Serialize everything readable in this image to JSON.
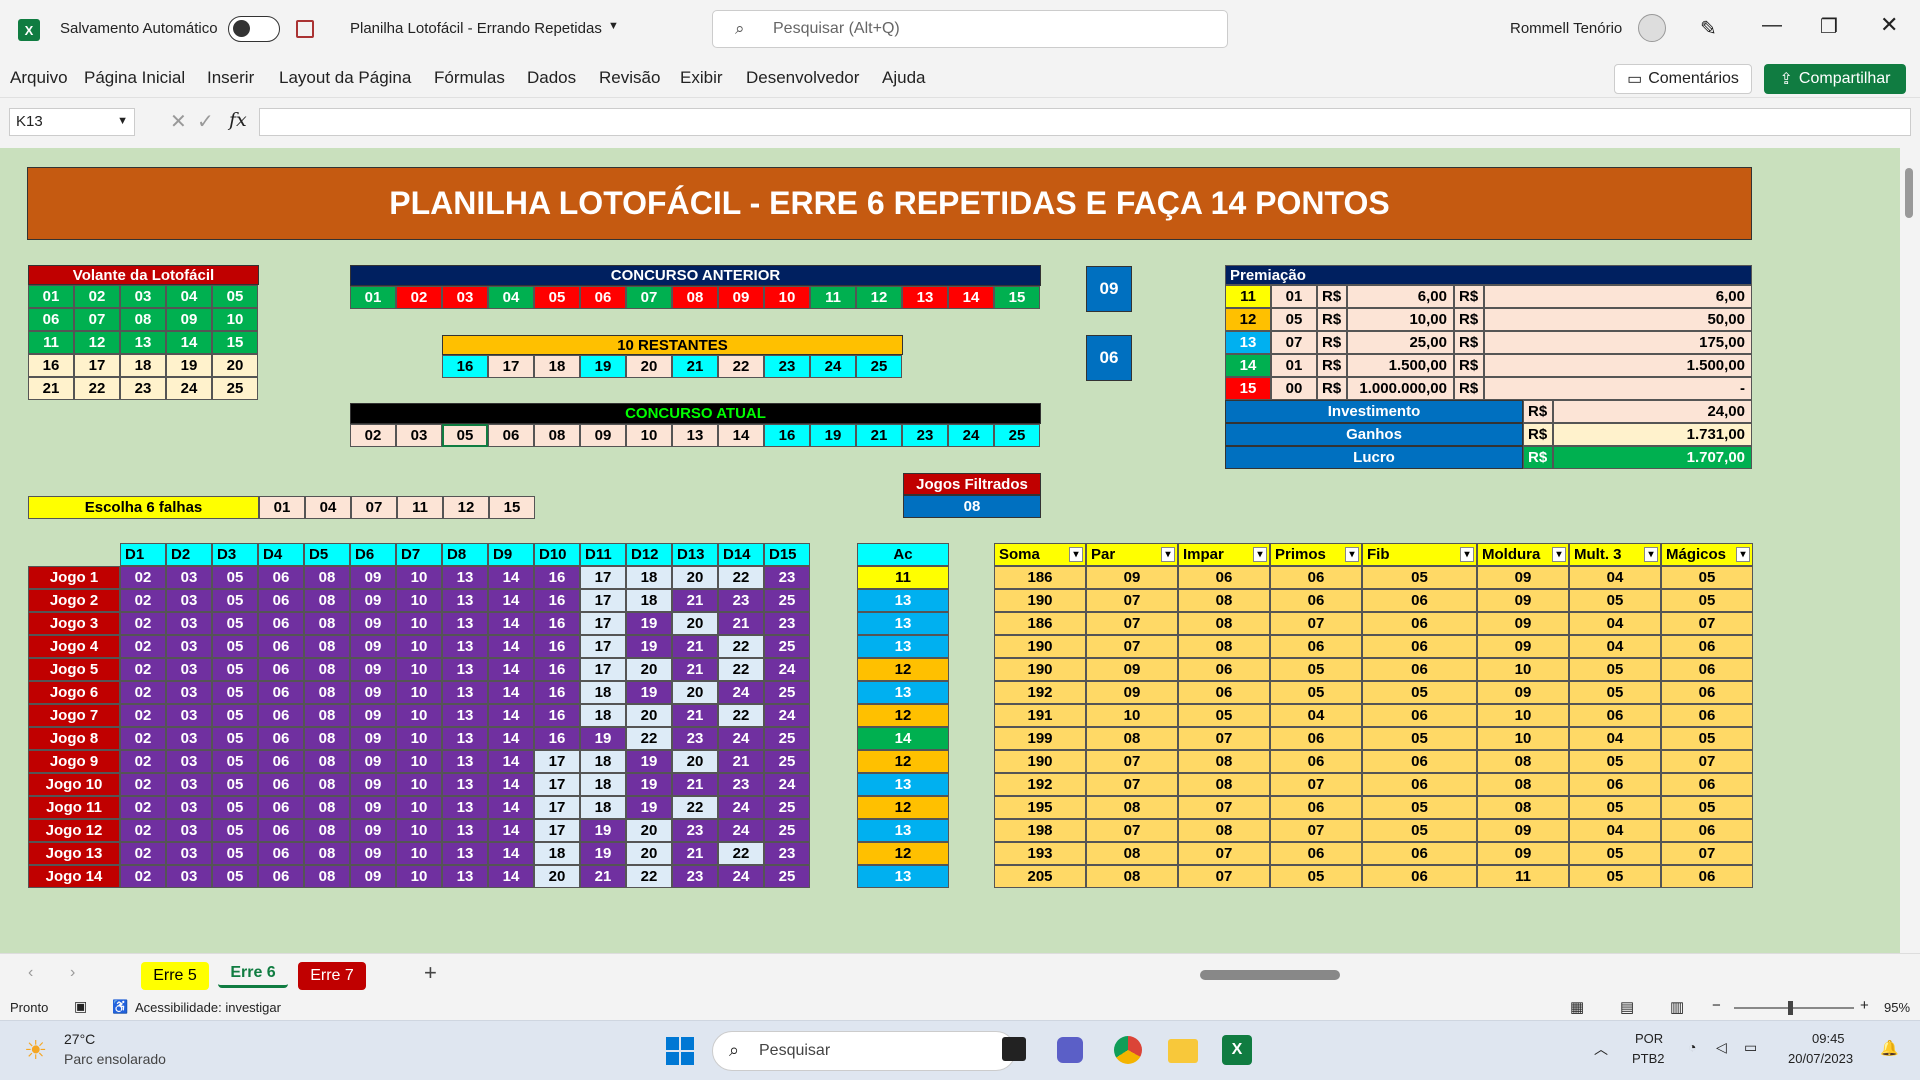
{
  "titlebar": {
    "autosave_label": "Salvamento Automático",
    "doc_title": "Planilha Lotofácil - Errando Repetidas",
    "search_placeholder": "Pesquisar (Alt+Q)",
    "user_name": "Rommell Tenório"
  },
  "menu": [
    "Arquivo",
    "Página Inicial",
    "Inserir",
    "Layout da Página",
    "Fórmulas",
    "Dados",
    "Revisão",
    "Exibir",
    "Desenvolvedor",
    "Ajuda"
  ],
  "ribbon_buttons": {
    "comments": "Comentários",
    "share": "Compartilhar"
  },
  "formula_bar": {
    "name_box": "K13",
    "fx": "fx",
    "formula": ""
  },
  "sheet": {
    "title": "PLANILHA LOTOFÁCIL - ERRE 6 REPETIDAS E FAÇA 14 PONTOS",
    "volante": {
      "title": "Volante da Lotofácil",
      "rows": [
        [
          "01",
          "02",
          "03",
          "04",
          "05"
        ],
        [
          "06",
          "07",
          "08",
          "09",
          "10"
        ],
        [
          "11",
          "12",
          "13",
          "14",
          "15"
        ],
        [
          "16",
          "17",
          "18",
          "19",
          "20"
        ],
        [
          "21",
          "22",
          "23",
          "24",
          "25"
        ]
      ]
    },
    "concurso_anterior": {
      "title": "CONCURSO ANTERIOR",
      "numbers": [
        "01",
        "02",
        "03",
        "04",
        "05",
        "06",
        "07",
        "08",
        "09",
        "10",
        "11",
        "12",
        "13",
        "14",
        "15"
      ],
      "colors": [
        "g",
        "r",
        "r",
        "g",
        "r",
        "r",
        "g",
        "r",
        "r",
        "r",
        "g",
        "g",
        "r",
        "r",
        "g"
      ]
    },
    "restantes": {
      "title": "10 RESTANTES",
      "numbers": [
        "16",
        "17",
        "18",
        "19",
        "20",
        "21",
        "22",
        "23",
        "24",
        "25"
      ],
      "colors": [
        "c",
        "p",
        "p",
        "c",
        "p",
        "c",
        "p",
        "c",
        "c",
        "c"
      ]
    },
    "concurso_atual": {
      "title": "CONCURSO ATUAL",
      "numbers": [
        "02",
        "03",
        "05",
        "06",
        "08",
        "09",
        "10",
        "13",
        "14",
        "16",
        "19",
        "21",
        "23",
        "24",
        "25"
      ],
      "colors": [
        "p",
        "p",
        "p",
        "p",
        "p",
        "p",
        "p",
        "p",
        "p",
        "c",
        "c",
        "c",
        "c",
        "c",
        "c"
      ]
    },
    "box_09": "09",
    "box_06": "06",
    "escolha": {
      "label": "Escolha 6 falhas",
      "numbers": [
        "01",
        "04",
        "07",
        "11",
        "12",
        "15"
      ]
    },
    "jogos_filtrados": {
      "label": "Jogos Filtrados",
      "value": "08"
    },
    "premiacao": {
      "title": "Premiação",
      "rows": [
        {
          "pts": "11",
          "qtd": "01",
          "rs1": "R$",
          "val": "6,00",
          "rs2": "R$",
          "tot": "6,00",
          "color": "#ffff00",
          "tc": "#000"
        },
        {
          "pts": "12",
          "qtd": "05",
          "rs1": "R$",
          "val": "10,00",
          "rs2": "R$",
          "tot": "50,00",
          "color": "#ffc000",
          "tc": "#000"
        },
        {
          "pts": "13",
          "qtd": "07",
          "rs1": "R$",
          "val": "25,00",
          "rs2": "R$",
          "tot": "175,00",
          "color": "#00b0f0",
          "tc": "#fff"
        },
        {
          "pts": "14",
          "qtd": "01",
          "rs1": "R$",
          "val": "1.500,00",
          "rs2": "R$",
          "tot": "1.500,00",
          "color": "#00b050",
          "tc": "#fff"
        },
        {
          "pts": "15",
          "qtd": "00",
          "rs1": "R$",
          "val": "1.000.000,00",
          "rs2": "R$",
          "tot": "-",
          "color": "#ff0000",
          "tc": "#fff"
        }
      ],
      "investimento": {
        "label": "Investimento",
        "rs": "R$",
        "value": "24,00"
      },
      "ganhos": {
        "label": "Ganhos",
        "rs": "R$",
        "value": "1.731,00"
      },
      "lucro": {
        "label": "Lucro",
        "rs": "R$",
        "value": "1.707,00"
      }
    },
    "games": {
      "headers": [
        "D1",
        "D2",
        "D3",
        "D4",
        "D5",
        "D6",
        "D7",
        "D8",
        "D9",
        "D10",
        "D11",
        "D12",
        "D13",
        "D14",
        "D15"
      ],
      "ac_header": "Ac",
      "stats_headers": [
        "Soma",
        "Par",
        "Impar",
        "Primos",
        "Fib",
        "Moldura",
        "Mult. 3",
        "Mágicos"
      ],
      "rows": [
        {
          "label": "Jogo 1",
          "nums": [
            "02",
            "03",
            "05",
            "06",
            "08",
            "09",
            "10",
            "13",
            "14",
            "16",
            "17",
            "18",
            "20",
            "22",
            "23"
          ],
          "ac": "11",
          "stats": [
            "186",
            "09",
            "06",
            "06",
            "05",
            "09",
            "04",
            "05"
          ]
        },
        {
          "label": "Jogo 2",
          "nums": [
            "02",
            "03",
            "05",
            "06",
            "08",
            "09",
            "10",
            "13",
            "14",
            "16",
            "17",
            "18",
            "21",
            "23",
            "25"
          ],
          "ac": "13",
          "stats": [
            "190",
            "07",
            "08",
            "06",
            "06",
            "09",
            "05",
            "05"
          ]
        },
        {
          "label": "Jogo 3",
          "nums": [
            "02",
            "03",
            "05",
            "06",
            "08",
            "09",
            "10",
            "13",
            "14",
            "16",
            "17",
            "19",
            "20",
            "21",
            "23"
          ],
          "ac": "13",
          "stats": [
            "186",
            "07",
            "08",
            "07",
            "06",
            "09",
            "04",
            "07"
          ]
        },
        {
          "label": "Jogo 4",
          "nums": [
            "02",
            "03",
            "05",
            "06",
            "08",
            "09",
            "10",
            "13",
            "14",
            "16",
            "17",
            "19",
            "21",
            "22",
            "25"
          ],
          "ac": "13",
          "stats": [
            "190",
            "07",
            "08",
            "06",
            "06",
            "09",
            "04",
            "06"
          ]
        },
        {
          "label": "Jogo 5",
          "nums": [
            "02",
            "03",
            "05",
            "06",
            "08",
            "09",
            "10",
            "13",
            "14",
            "16",
            "17",
            "20",
            "21",
            "22",
            "24"
          ],
          "ac": "12",
          "stats": [
            "190",
            "09",
            "06",
            "05",
            "06",
            "10",
            "05",
            "06"
          ]
        },
        {
          "label": "Jogo 6",
          "nums": [
            "02",
            "03",
            "05",
            "06",
            "08",
            "09",
            "10",
            "13",
            "14",
            "16",
            "18",
            "19",
            "20",
            "24",
            "25"
          ],
          "ac": "13",
          "stats": [
            "192",
            "09",
            "06",
            "05",
            "05",
            "09",
            "05",
            "06"
          ]
        },
        {
          "label": "Jogo 7",
          "nums": [
            "02",
            "03",
            "05",
            "06",
            "08",
            "09",
            "10",
            "13",
            "14",
            "16",
            "18",
            "20",
            "21",
            "22",
            "24"
          ],
          "ac": "12",
          "stats": [
            "191",
            "10",
            "05",
            "04",
            "06",
            "10",
            "06",
            "06"
          ]
        },
        {
          "label": "Jogo 8",
          "nums": [
            "02",
            "03",
            "05",
            "06",
            "08",
            "09",
            "10",
            "13",
            "14",
            "16",
            "19",
            "22",
            "23",
            "24",
            "25"
          ],
          "ac": "14",
          "stats": [
            "199",
            "08",
            "07",
            "06",
            "05",
            "10",
            "04",
            "05"
          ]
        },
        {
          "label": "Jogo 9",
          "nums": [
            "02",
            "03",
            "05",
            "06",
            "08",
            "09",
            "10",
            "13",
            "14",
            "17",
            "18",
            "19",
            "20",
            "21",
            "25"
          ],
          "ac": "12",
          "stats": [
            "190",
            "07",
            "08",
            "06",
            "06",
            "08",
            "05",
            "07"
          ]
        },
        {
          "label": "Jogo 10",
          "nums": [
            "02",
            "03",
            "05",
            "06",
            "08",
            "09",
            "10",
            "13",
            "14",
            "17",
            "18",
            "19",
            "21",
            "23",
            "24"
          ],
          "ac": "13",
          "stats": [
            "192",
            "07",
            "08",
            "07",
            "06",
            "08",
            "06",
            "06"
          ]
        },
        {
          "label": "Jogo 11",
          "nums": [
            "02",
            "03",
            "05",
            "06",
            "08",
            "09",
            "10",
            "13",
            "14",
            "17",
            "18",
            "19",
            "22",
            "24",
            "25"
          ],
          "ac": "12",
          "stats": [
            "195",
            "08",
            "07",
            "06",
            "05",
            "08",
            "05",
            "05"
          ]
        },
        {
          "label": "Jogo 12",
          "nums": [
            "02",
            "03",
            "05",
            "06",
            "08",
            "09",
            "10",
            "13",
            "14",
            "17",
            "19",
            "20",
            "23",
            "24",
            "25"
          ],
          "ac": "13",
          "stats": [
            "198",
            "07",
            "08",
            "07",
            "05",
            "09",
            "04",
            "06"
          ]
        },
        {
          "label": "Jogo 13",
          "nums": [
            "02",
            "03",
            "05",
            "06",
            "08",
            "09",
            "10",
            "13",
            "14",
            "18",
            "19",
            "20",
            "21",
            "22",
            "23"
          ],
          "ac": "12",
          "stats": [
            "193",
            "08",
            "07",
            "06",
            "06",
            "09",
            "05",
            "07"
          ]
        },
        {
          "label": "Jogo 14",
          "nums": [
            "02",
            "03",
            "05",
            "06",
            "08",
            "09",
            "10",
            "13",
            "14",
            "20",
            "21",
            "22",
            "23",
            "24",
            "25"
          ],
          "ac": "13",
          "stats": [
            "205",
            "08",
            "07",
            "05",
            "06",
            "11",
            "05",
            "06"
          ]
        }
      ]
    }
  },
  "sheet_tabs": [
    {
      "label": "Erre 5"
    },
    {
      "label": "Erre 6"
    },
    {
      "label": "Erre 7"
    }
  ],
  "status": {
    "ready": "Pronto",
    "accessibility": "Acessibilidade: investigar",
    "zoom": "95%"
  },
  "taskbar": {
    "temp": "27°C",
    "weather": "Parc ensolarado",
    "search": "Pesquisar",
    "lang1": "POR",
    "lang2": "PTB2",
    "time": "09:45",
    "date": "20/07/2023"
  },
  "colors": {
    "green": "#00b050",
    "red": "#ff0000",
    "cyan": "#00ffff",
    "peach": "#fce4d6",
    "purple": "#7030a0",
    "title_bg": "#c55a11",
    "navy": "#002060",
    "blue": "#0070c0"
  }
}
